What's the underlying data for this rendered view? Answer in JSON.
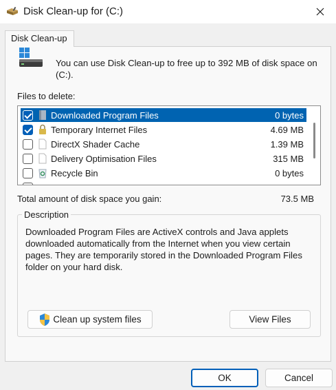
{
  "window": {
    "title": "Disk Clean-up for  (C:)",
    "close_icon": "close-icon",
    "title_icon": "disk-cleanup-icon"
  },
  "tab": {
    "label": "Disk Clean-up"
  },
  "intro": {
    "text": "You can use Disk Clean-up to free up to 392 MB of disk space on (C:)."
  },
  "files": {
    "label": "Files to delete:",
    "items": [
      {
        "name": "Downloaded Program Files",
        "size": "0 bytes",
        "checked": true,
        "selected": true,
        "icon": "folder-icon"
      },
      {
        "name": "Temporary Internet Files",
        "size": "4.69 MB",
        "checked": true,
        "selected": false,
        "icon": "lock-icon"
      },
      {
        "name": "DirectX Shader Cache",
        "size": "1.39 MB",
        "checked": false,
        "selected": false,
        "icon": "file-icon"
      },
      {
        "name": "Delivery Optimisation Files",
        "size": "315 MB",
        "checked": false,
        "selected": false,
        "icon": "file-icon"
      },
      {
        "name": "Recycle Bin",
        "size": "0 bytes",
        "checked": false,
        "selected": false,
        "icon": "recycle-bin-icon"
      }
    ]
  },
  "total": {
    "label": "Total amount of disk space you gain:",
    "value": "73.5 MB"
  },
  "description": {
    "legend": "Description",
    "text": "Downloaded Program Files are ActiveX controls and Java applets downloaded automatically from the Internet when you view certain pages. They are temporarily stored in the Downloaded Program Files folder on your hard disk."
  },
  "buttons": {
    "cleanup": "Clean up system files",
    "view": "View Files",
    "ok": "OK",
    "cancel": "Cancel"
  },
  "colors": {
    "accent": "#005fb8",
    "selection": "#0063b1"
  }
}
